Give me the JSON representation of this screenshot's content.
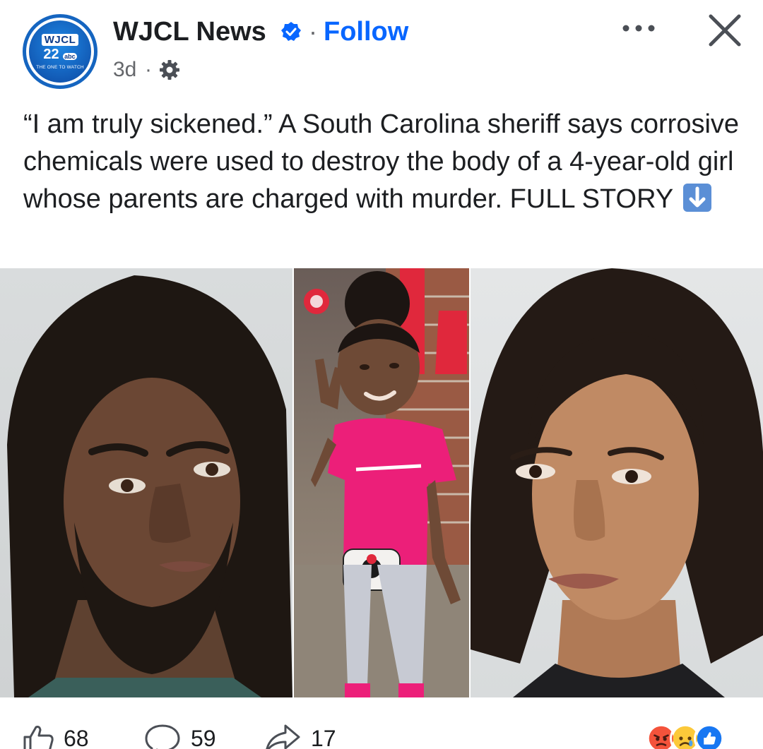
{
  "post": {
    "page_name": "WJCL News",
    "follow_label": "Follow",
    "separator": "·",
    "time": "3d",
    "time_separator": "·",
    "logo": {
      "name": "WJCL",
      "channel": "22",
      "network": "abc",
      "tagline": "THE ONE TO WATCH"
    },
    "caption_main": "“I am truly sickened.” A South Carolina sheriff says corrosive chemicals were used to destroy the body of a 4-year-old girl whose parents are charged with murder. FULL STORY",
    "icons": {
      "verified": "verified-badge-icon",
      "audience": "gear-icon",
      "more": "more-options-icon",
      "close": "close-icon",
      "caption_arrow": "down-arrow-emoji"
    }
  },
  "reactions": {
    "like_count": "68",
    "comment_count": "59",
    "share_count": "17",
    "summary_icons": [
      "angry-reaction-icon",
      "sad-reaction-icon",
      "like-reaction-icon"
    ]
  },
  "colors": {
    "brand_blue": "#0866ff",
    "text": "#1c1e21",
    "secondary_text": "#65676b"
  }
}
